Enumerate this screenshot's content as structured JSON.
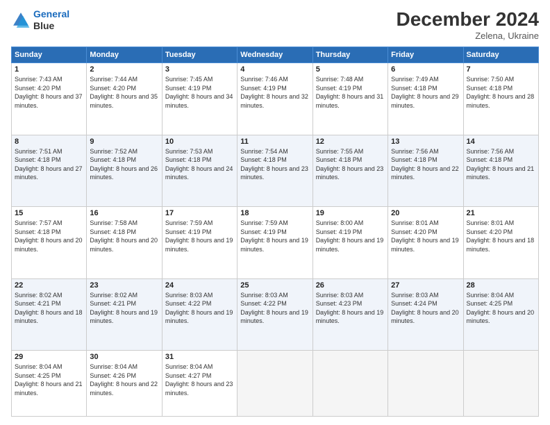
{
  "header": {
    "logo_line1": "General",
    "logo_line2": "Blue",
    "month": "December 2024",
    "location": "Zelena, Ukraine"
  },
  "days_of_week": [
    "Sunday",
    "Monday",
    "Tuesday",
    "Wednesday",
    "Thursday",
    "Friday",
    "Saturday"
  ],
  "weeks": [
    [
      {
        "day": "1",
        "sunrise": "7:43 AM",
        "sunset": "4:20 PM",
        "daylight": "8 hours and 37 minutes."
      },
      {
        "day": "2",
        "sunrise": "7:44 AM",
        "sunset": "4:20 PM",
        "daylight": "8 hours and 35 minutes."
      },
      {
        "day": "3",
        "sunrise": "7:45 AM",
        "sunset": "4:19 PM",
        "daylight": "8 hours and 34 minutes."
      },
      {
        "day": "4",
        "sunrise": "7:46 AM",
        "sunset": "4:19 PM",
        "daylight": "8 hours and 32 minutes."
      },
      {
        "day": "5",
        "sunrise": "7:48 AM",
        "sunset": "4:19 PM",
        "daylight": "8 hours and 31 minutes."
      },
      {
        "day": "6",
        "sunrise": "7:49 AM",
        "sunset": "4:18 PM",
        "daylight": "8 hours and 29 minutes."
      },
      {
        "day": "7",
        "sunrise": "7:50 AM",
        "sunset": "4:18 PM",
        "daylight": "8 hours and 28 minutes."
      }
    ],
    [
      {
        "day": "8",
        "sunrise": "7:51 AM",
        "sunset": "4:18 PM",
        "daylight": "8 hours and 27 minutes."
      },
      {
        "day": "9",
        "sunrise": "7:52 AM",
        "sunset": "4:18 PM",
        "daylight": "8 hours and 26 minutes."
      },
      {
        "day": "10",
        "sunrise": "7:53 AM",
        "sunset": "4:18 PM",
        "daylight": "8 hours and 24 minutes."
      },
      {
        "day": "11",
        "sunrise": "7:54 AM",
        "sunset": "4:18 PM",
        "daylight": "8 hours and 23 minutes."
      },
      {
        "day": "12",
        "sunrise": "7:55 AM",
        "sunset": "4:18 PM",
        "daylight": "8 hours and 23 minutes."
      },
      {
        "day": "13",
        "sunrise": "7:56 AM",
        "sunset": "4:18 PM",
        "daylight": "8 hours and 22 minutes."
      },
      {
        "day": "14",
        "sunrise": "7:56 AM",
        "sunset": "4:18 PM",
        "daylight": "8 hours and 21 minutes."
      }
    ],
    [
      {
        "day": "15",
        "sunrise": "7:57 AM",
        "sunset": "4:18 PM",
        "daylight": "8 hours and 20 minutes."
      },
      {
        "day": "16",
        "sunrise": "7:58 AM",
        "sunset": "4:18 PM",
        "daylight": "8 hours and 20 minutes."
      },
      {
        "day": "17",
        "sunrise": "7:59 AM",
        "sunset": "4:19 PM",
        "daylight": "8 hours and 19 minutes."
      },
      {
        "day": "18",
        "sunrise": "7:59 AM",
        "sunset": "4:19 PM",
        "daylight": "8 hours and 19 minutes."
      },
      {
        "day": "19",
        "sunrise": "8:00 AM",
        "sunset": "4:19 PM",
        "daylight": "8 hours and 19 minutes."
      },
      {
        "day": "20",
        "sunrise": "8:01 AM",
        "sunset": "4:20 PM",
        "daylight": "8 hours and 19 minutes."
      },
      {
        "day": "21",
        "sunrise": "8:01 AM",
        "sunset": "4:20 PM",
        "daylight": "8 hours and 18 minutes."
      }
    ],
    [
      {
        "day": "22",
        "sunrise": "8:02 AM",
        "sunset": "4:21 PM",
        "daylight": "8 hours and 18 minutes."
      },
      {
        "day": "23",
        "sunrise": "8:02 AM",
        "sunset": "4:21 PM",
        "daylight": "8 hours and 19 minutes."
      },
      {
        "day": "24",
        "sunrise": "8:03 AM",
        "sunset": "4:22 PM",
        "daylight": "8 hours and 19 minutes."
      },
      {
        "day": "25",
        "sunrise": "8:03 AM",
        "sunset": "4:22 PM",
        "daylight": "8 hours and 19 minutes."
      },
      {
        "day": "26",
        "sunrise": "8:03 AM",
        "sunset": "4:23 PM",
        "daylight": "8 hours and 19 minutes."
      },
      {
        "day": "27",
        "sunrise": "8:03 AM",
        "sunset": "4:24 PM",
        "daylight": "8 hours and 20 minutes."
      },
      {
        "day": "28",
        "sunrise": "8:04 AM",
        "sunset": "4:25 PM",
        "daylight": "8 hours and 20 minutes."
      }
    ],
    [
      {
        "day": "29",
        "sunrise": "8:04 AM",
        "sunset": "4:25 PM",
        "daylight": "8 hours and 21 minutes."
      },
      {
        "day": "30",
        "sunrise": "8:04 AM",
        "sunset": "4:26 PM",
        "daylight": "8 hours and 22 minutes."
      },
      {
        "day": "31",
        "sunrise": "8:04 AM",
        "sunset": "4:27 PM",
        "daylight": "8 hours and 23 minutes."
      },
      null,
      null,
      null,
      null
    ]
  ]
}
